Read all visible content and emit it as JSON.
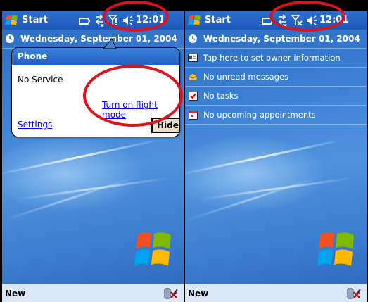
{
  "left": {
    "taskbar": {
      "start_label": "Start",
      "time": "12:01"
    },
    "today": {
      "date": "Wednesday, September 01, 2004"
    },
    "phone_popup": {
      "title": "Phone",
      "status": "No Service",
      "flight_mode_link": "Turn on flight mode",
      "settings_link": "Settings",
      "hide_button": "Hide"
    },
    "cmdbar": {
      "new_label": "New"
    }
  },
  "right": {
    "taskbar": {
      "start_label": "Start",
      "time": "12:01"
    },
    "today": {
      "date": "Wednesday, September 01, 2004",
      "items": [
        {
          "label": "Tap here to set owner information",
          "icon": "owner-card-icon"
        },
        {
          "label": "No unread messages",
          "icon": "envelope-icon"
        },
        {
          "label": "No tasks",
          "icon": "tasks-checkbox-icon"
        },
        {
          "label": "No upcoming appointments",
          "icon": "calendar-icon"
        }
      ]
    },
    "cmdbar": {
      "new_label": "New"
    }
  },
  "colors": {
    "taskbar": "#1e58b8",
    "highlight_ring": "#e0101c",
    "link": "#0000ee",
    "cmdbar": "#d9e7f7"
  }
}
